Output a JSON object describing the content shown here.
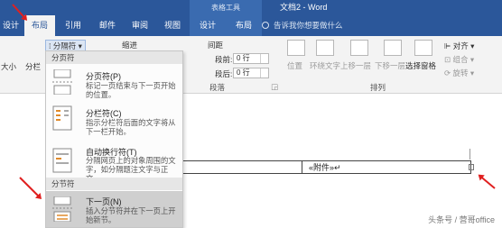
{
  "window": {
    "context_group": "表格工具",
    "title": "文档2 - Word"
  },
  "tabs": [
    {
      "label": "设计"
    },
    {
      "label": "布局"
    },
    {
      "label": "引用"
    },
    {
      "label": "邮件"
    },
    {
      "label": "审阅"
    },
    {
      "label": "视图"
    },
    {
      "label": "设计"
    },
    {
      "label": "布局"
    }
  ],
  "tell_me": "告诉我你想要做什么",
  "ribbon": {
    "breaks_button": "分隔符",
    "indent_label": "缩进",
    "spacing_label": "间距",
    "spacing_before_label": "段前:",
    "spacing_after_label": "段后:",
    "spacing_before_value": "0 行",
    "spacing_after_value": "0 行",
    "paragraph_group": "段落",
    "arrange_group": "排列",
    "arrange_buttons": {
      "position": "位置",
      "wrap_text": "环绕文字",
      "bring_forward": "上移一层",
      "send_backward": "下移一层",
      "selection_pane": "选择窗格",
      "align": "对齐",
      "group": "组合",
      "rotate": "旋转"
    },
    "left_cut_labels": [
      "大小",
      "分栏"
    ]
  },
  "breaks_menu": {
    "page_breaks_header": "分页符",
    "section_breaks_header": "分节符",
    "items": [
      {
        "title": "分页符(P)",
        "desc": "标记一页结束与下一页开始的位置。",
        "icon": "page-break-icon"
      },
      {
        "title": "分栏符(C)",
        "desc": "指示分栏符后面的文字将从下一栏开始。",
        "icon": "column-break-icon"
      },
      {
        "title": "自动换行符(T)",
        "desc": "分隔网页上的对象周围的文字，如分隔题注文字与正文。",
        "icon": "text-wrap-break-icon"
      },
      {
        "title": "下一页(N)",
        "desc": "插入分节符并在下一页上开始新节。",
        "icon": "next-page-section-icon"
      }
    ]
  },
  "document": {
    "cell_text": "«附件»↵"
  },
  "watermark": "头条号 / 营哥office",
  "colors": {
    "accent": "#2b579a",
    "arrow": "#e02020"
  }
}
